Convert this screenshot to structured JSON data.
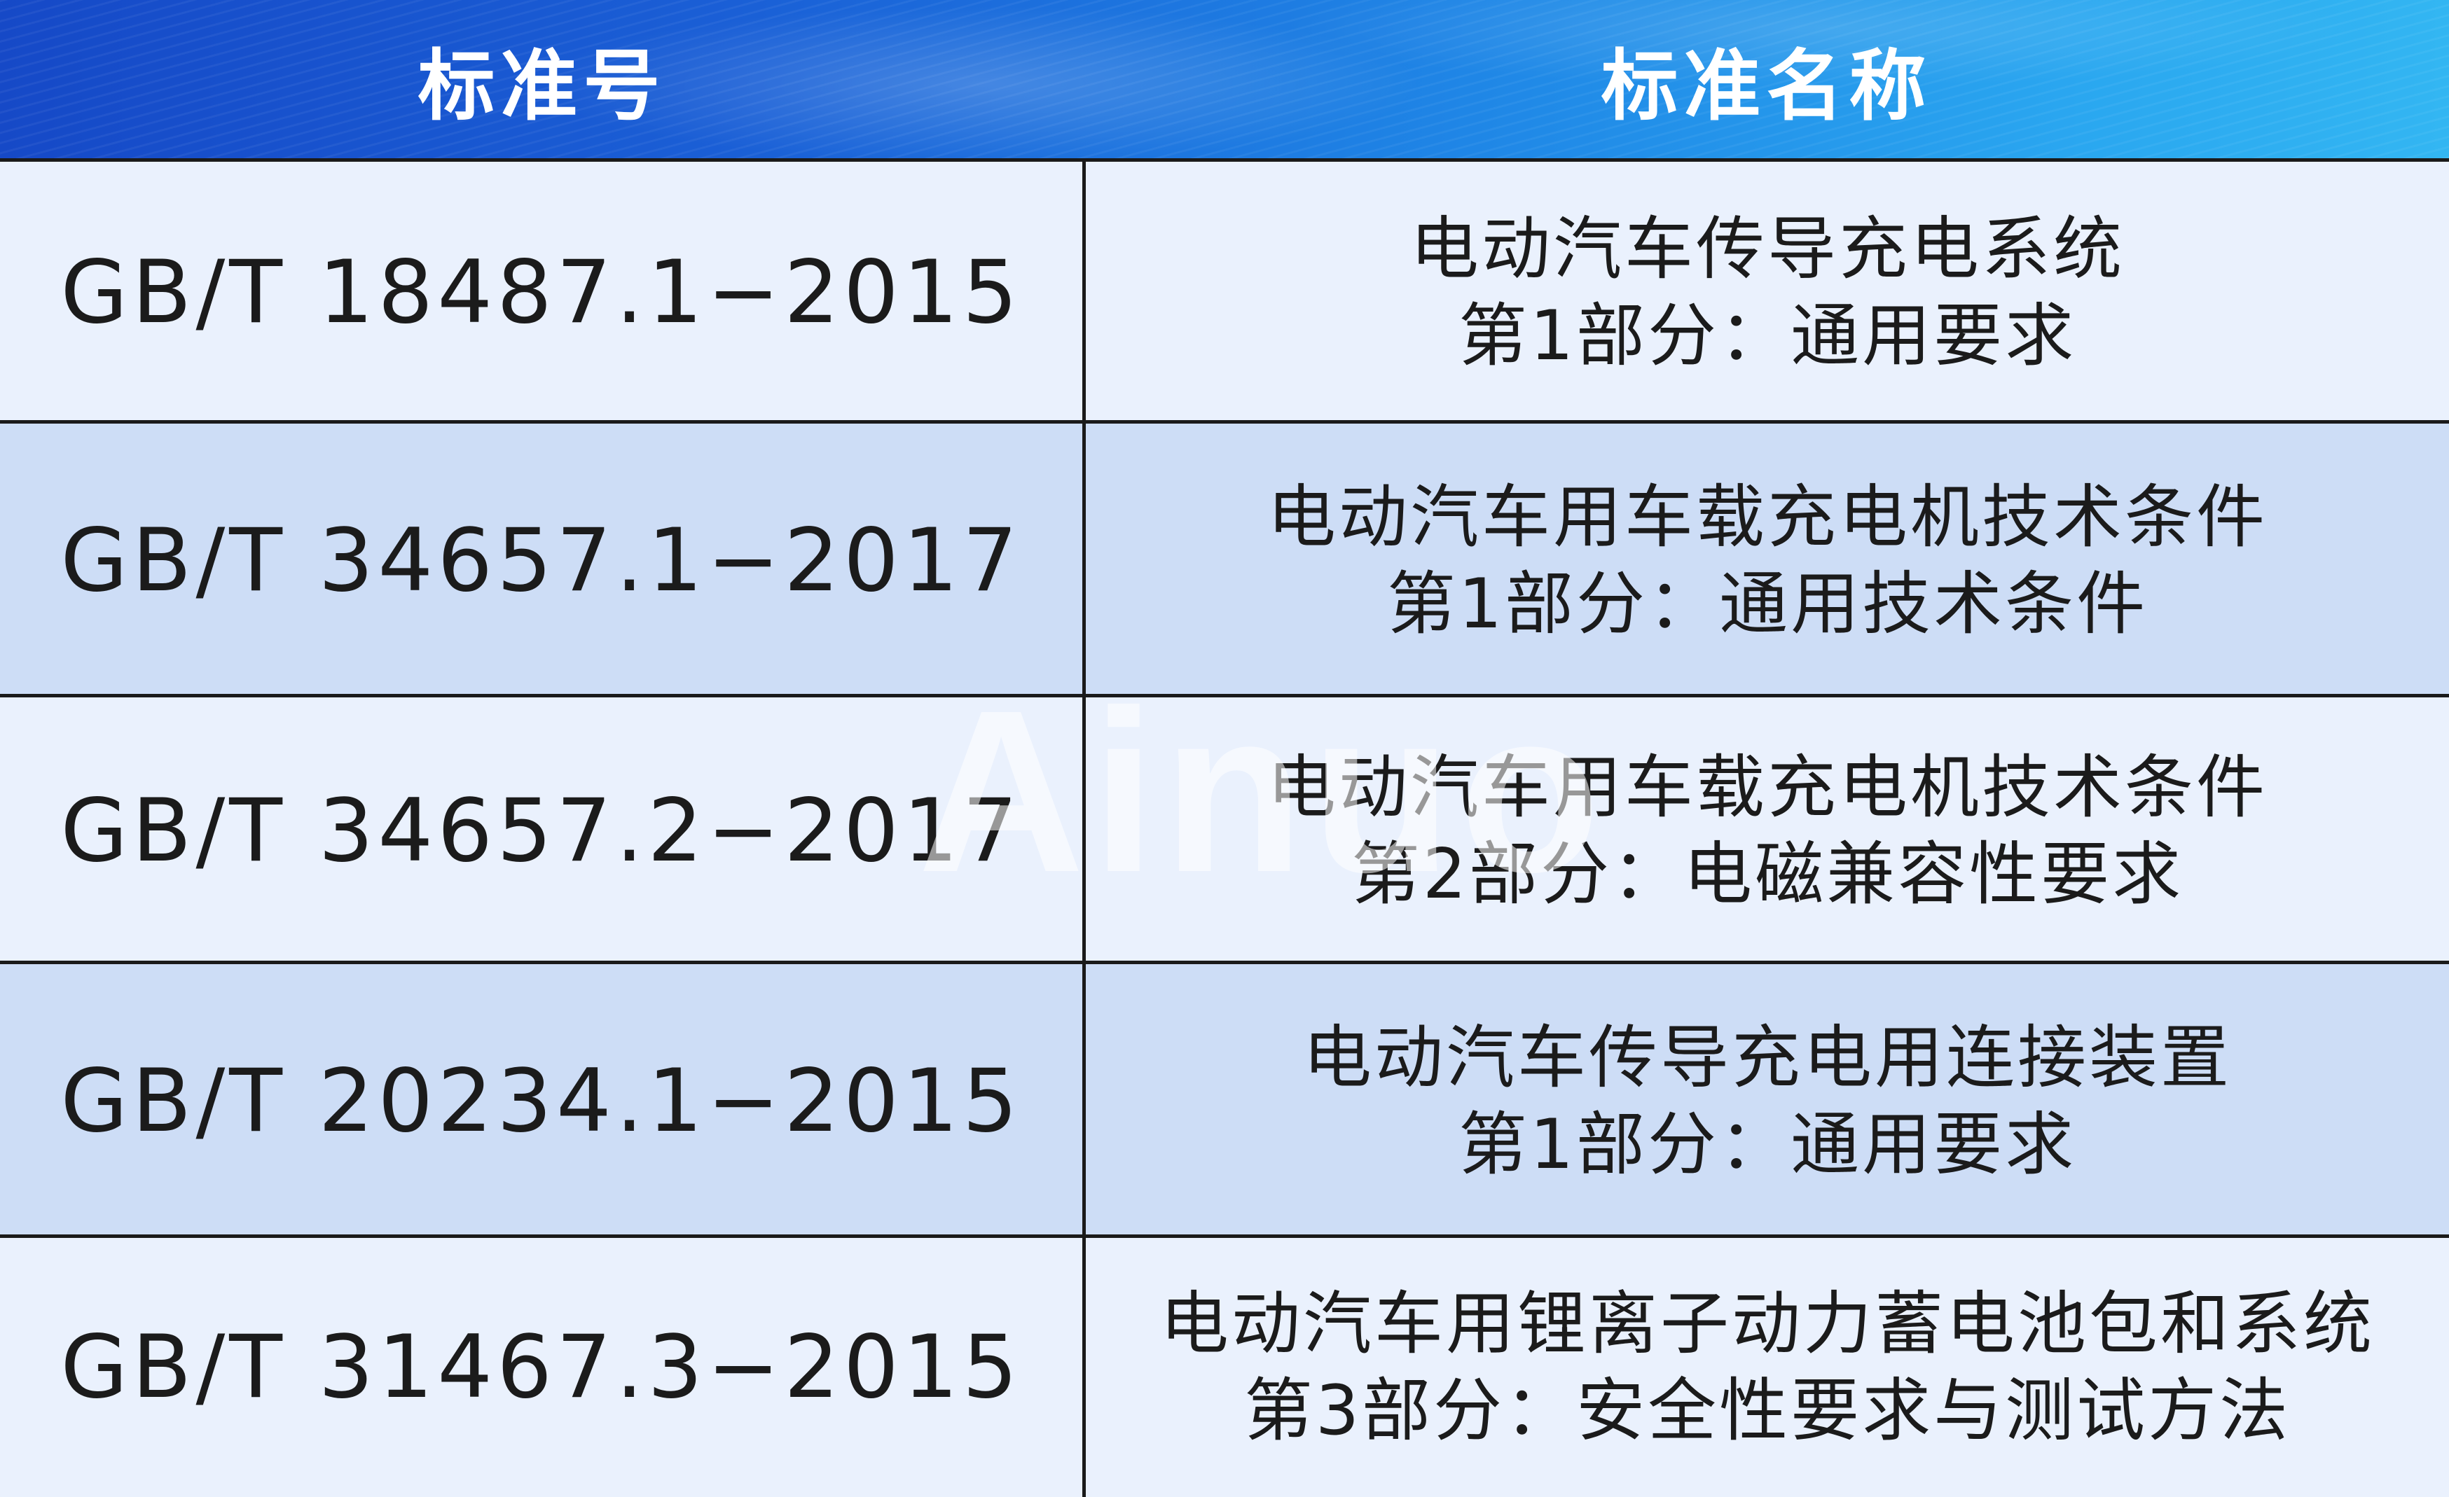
{
  "header": {
    "col1": "标准号",
    "col2": "标准名称"
  },
  "rows": [
    {
      "code": "GB/T 18487.1−2015",
      "name_line1": "电动汽车传导充电系统",
      "name_line2": "第1部分：通用要求"
    },
    {
      "code": "GB/T 34657.1−2017",
      "name_line1": "电动汽车用车载充电机技术条件",
      "name_line2": "第1部分：通用技术条件"
    },
    {
      "code": "GB/T 34657.2−2017",
      "name_line1": "电动汽车用车载充电机技术条件",
      "name_line2": "第2部分：电磁兼容性要求"
    },
    {
      "code": "GB/T 20234.1−2015",
      "name_line1": "电动汽车传导充电用连接装置",
      "name_line2": "第1部分：通用要求"
    },
    {
      "code": "GB/T 31467.3−2015",
      "name_line1": "电动汽车用锂离子动力蓄电池包和系统",
      "name_line2": "第3部分：安全性要求与测试方法"
    }
  ],
  "watermark": "Ainuo",
  "colors": {
    "header_start": "#1649c7",
    "header_end": "#33b6f2",
    "row_light": "#eaf1fd",
    "row_dark": "#cdddf6",
    "border": "#1a1a1a"
  }
}
